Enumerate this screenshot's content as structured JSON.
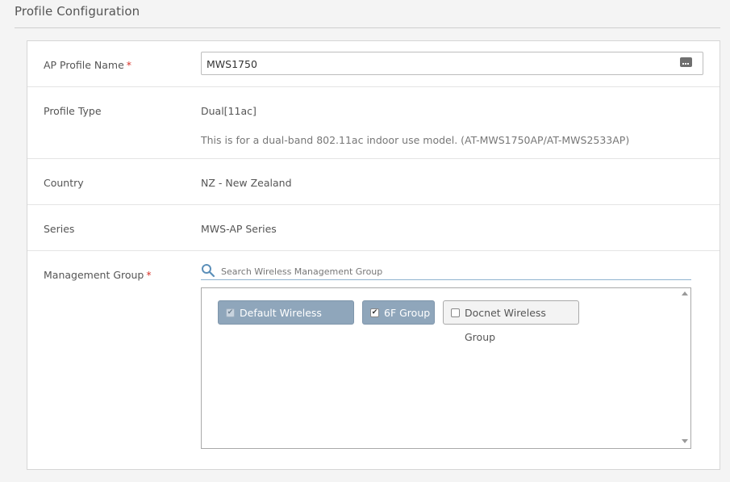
{
  "page": {
    "title": "Profile Configuration"
  },
  "form": {
    "ap_profile_name": {
      "label": "AP Profile Name",
      "required_mark": "*",
      "value": "MWS1750",
      "icon": "keyboard-icon"
    },
    "profile_type": {
      "label": "Profile Type",
      "value": "Dual[11ac]",
      "description": "This is for a dual-band 802.11ac indoor use model. (AT-MWS1750AP/AT-MWS2533AP)"
    },
    "country": {
      "label": "Country",
      "value": "NZ - New Zealand"
    },
    "series": {
      "label": "Series",
      "value": "MWS-AP Series"
    },
    "management_group": {
      "label": "Management Group",
      "required_mark": "*",
      "search_placeholder": "Search Wireless Management Group",
      "groups": [
        {
          "label": "Default Wireless Group",
          "checked": true,
          "disabled": true,
          "selected": true
        },
        {
          "label": "6F Group",
          "checked": true,
          "disabled": false,
          "selected": true
        },
        {
          "label": "Docnet Wireless Group",
          "checked": false,
          "disabled": false,
          "selected": false
        }
      ]
    }
  },
  "colors": {
    "accent": "#8fa6bb",
    "required": "#d9352b",
    "search_underline": "#8eb3cf"
  }
}
